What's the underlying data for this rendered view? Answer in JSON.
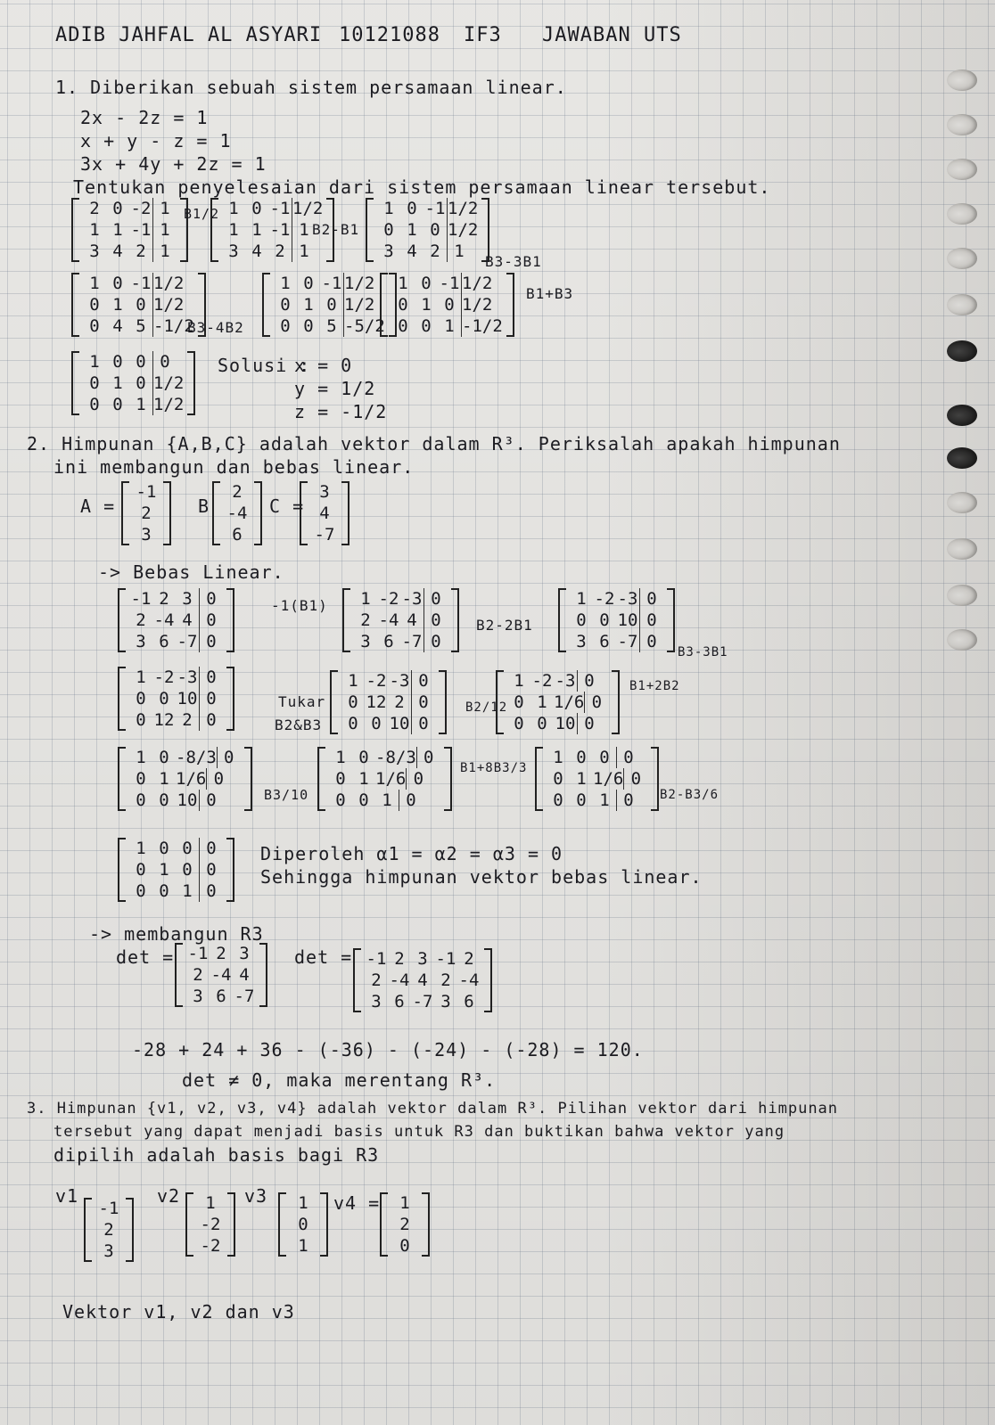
{
  "header": {
    "name": "ADIB JAHFAL AL ASYARI",
    "nim": "10121088",
    "class": "IF3",
    "title": "JAWABAN UTS"
  },
  "q1": {
    "intro": "1. Diberikan sebuah sistem persamaan linear.",
    "eqs": [
      "2x  -  2z = 1",
      "x + y - z = 1",
      "3x + 4y + 2z = 1"
    ],
    "task": "Tentukan penyelesaian dari sistem persamaan linear tersebut.",
    "m1": [
      [
        "2",
        "0",
        "-2",
        "1"
      ],
      [
        "1",
        "1",
        "-1",
        "1"
      ],
      [
        "3",
        "4",
        "2",
        "1"
      ]
    ],
    "op1": "B1/2",
    "m2": [
      [
        "1",
        "0",
        "-1",
        "1/2"
      ],
      [
        "1",
        "1",
        "-1",
        "1"
      ],
      [
        "3",
        "4",
        "2",
        "1"
      ]
    ],
    "op2": "B2-B1",
    "m3": [
      [
        "1",
        "0",
        "-1",
        "1/2"
      ],
      [
        "0",
        "1",
        "0",
        "1/2"
      ],
      [
        "3",
        "4",
        "2",
        "1"
      ]
    ],
    "op3": "B3-3B1",
    "m4": [
      [
        "1",
        "0",
        "-1",
        "1/2"
      ],
      [
        "0",
        "1",
        "0",
        "1/2"
      ],
      [
        "0",
        "4",
        "5",
        "-1/2"
      ]
    ],
    "op4": "B3-4B2",
    "m5": [
      [
        "1",
        "0",
        "-1",
        "1/2"
      ],
      [
        "0",
        "1",
        "0",
        "1/2"
      ],
      [
        "0",
        "0",
        "5",
        "-5/2"
      ]
    ],
    "m6": [
      [
        "1",
        "0",
        "-1",
        "1/2"
      ],
      [
        "0",
        "1",
        "0",
        "1/2"
      ],
      [
        "0",
        "0",
        "1",
        "-1/2"
      ]
    ],
    "op6": "B1+B3",
    "m7": [
      [
        "1",
        "0",
        "0",
        "0"
      ],
      [
        "0",
        "1",
        "0",
        "1/2"
      ],
      [
        "0",
        "0",
        "1",
        "1/2"
      ]
    ],
    "sol_label": "Solusi :",
    "sol": [
      "x = 0",
      "y = 1/2",
      "z = -1/2"
    ]
  },
  "q2": {
    "intro1": "2. Himpunan {A,B,C} adalah vektor dalam R³. Periksalah apakah himpunan",
    "intro2": "ini membangun dan bebas linear.",
    "A": [
      "-1",
      "2",
      "3"
    ],
    "B": [
      "2",
      "-4",
      "6"
    ],
    "C": [
      "3",
      "4",
      "-7"
    ],
    "a_label": "A =",
    "b_label": "B",
    "c_label": "C =",
    "bebas": "-> Bebas Linear.",
    "n1": [
      [
        "-1",
        "2",
        "3",
        "0"
      ],
      [
        "2",
        "-4",
        "4",
        "0"
      ],
      [
        "3",
        "6",
        "-7",
        "0"
      ]
    ],
    "op1": "-1(B1)",
    "n2": [
      [
        "1",
        "-2",
        "-3",
        "0"
      ],
      [
        "2",
        "-4",
        "4",
        "0"
      ],
      [
        "3",
        "6",
        "-7",
        "0"
      ]
    ],
    "op2": "B2-2B1",
    "n3": [
      [
        "1",
        "-2",
        "-3",
        "0"
      ],
      [
        "0",
        "0",
        "10",
        "0"
      ],
      [
        "3",
        "6",
        "-7",
        "0"
      ]
    ],
    "op3": "B3-3B1",
    "n4": [
      [
        "1",
        "-2",
        "-3",
        "0"
      ],
      [
        "0",
        "0",
        "10",
        "0"
      ],
      [
        "0",
        "12",
        "2",
        "0"
      ]
    ],
    "op4a": "Tukar",
    "op4b": "B2&B3",
    "n5": [
      [
        "1",
        "-2",
        "-3",
        "0"
      ],
      [
        "0",
        "12",
        "2",
        "0"
      ],
      [
        "0",
        "0",
        "10",
        "0"
      ]
    ],
    "op5": "B2/12",
    "n6": [
      [
        "1",
        "-2",
        "-3",
        "0"
      ],
      [
        "0",
        "1",
        "1/6",
        "0"
      ],
      [
        "0",
        "0",
        "10",
        "0"
      ]
    ],
    "op6": "B1+2B2",
    "n7": [
      [
        "1",
        "0",
        "-8/3",
        "0"
      ],
      [
        "0",
        "1",
        "1/6",
        "0"
      ],
      [
        "0",
        "0",
        "10",
        "0"
      ]
    ],
    "op7": "B3/10",
    "n8": [
      [
        "1",
        "0",
        "-8/3",
        "0"
      ],
      [
        "0",
        "1",
        "1/6",
        "0"
      ],
      [
        "0",
        "0",
        "1",
        "0"
      ]
    ],
    "op8": "B1+8B3/3",
    "n9": [
      [
        "1",
        "0",
        "0",
        "0"
      ],
      [
        "0",
        "1",
        "1/6",
        "0"
      ],
      [
        "0",
        "0",
        "1",
        "0"
      ]
    ],
    "op9": "B2-B3/6",
    "n10": [
      [
        "1",
        "0",
        "0",
        "0"
      ],
      [
        "0",
        "1",
        "0",
        "0"
      ],
      [
        "0",
        "0",
        "1",
        "0"
      ]
    ],
    "concl1": "Diperoleh α1 = α2 = α3 = 0",
    "concl2": "Sehingga himpunan vektor bebas linear.",
    "span": "-> membangun R3",
    "det_label": "det =",
    "det": [
      [
        "-1",
        "2",
        "3"
      ],
      [
        "2",
        "-4",
        "4"
      ],
      [
        "3",
        "6",
        "-7"
      ]
    ],
    "det_label2": "det =",
    "det_ext": [
      [
        "-1",
        "2",
        "3",
        "-1",
        "2"
      ],
      [
        "2",
        "-4",
        "4",
        "2",
        "-4"
      ],
      [
        "3",
        "6",
        "-7",
        "3",
        "6"
      ]
    ],
    "calc": "-28 + 24 + 36 - (-36) - (-24) - (-28) = 120.",
    "concl3": "det ≠ 0, maka merentang R³."
  },
  "q3": {
    "intro1": "3. Himpunan {v1, v2, v3, v4} adalah vektor dalam R³. Pilihan vektor dari himpunan",
    "intro2": "tersebut yang dapat menjadi basis untuk R3 dan buktikan bahwa vektor yang",
    "intro3": "dipilih adalah basis bagi R3",
    "v1_label": "v1",
    "v2_label": "v2",
    "v3_label": "v3",
    "v4_label": "v4 =",
    "v1": [
      "-1",
      "2",
      "3"
    ],
    "v2": [
      "1",
      "-2",
      "-2"
    ],
    "v3": [
      "1",
      "0",
      "1"
    ],
    "v4": [
      "1",
      "2",
      "0"
    ],
    "last": "Vektor v1, v2 dan v3"
  }
}
